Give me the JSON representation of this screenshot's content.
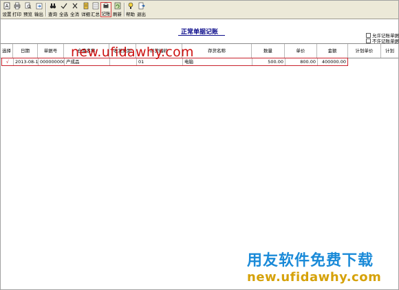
{
  "toolbar": {
    "buttons": [
      {
        "label": "设置",
        "icon": "settings-icon"
      },
      {
        "label": "打印",
        "icon": "printer-icon"
      },
      {
        "label": "预览",
        "icon": "preview-icon"
      },
      {
        "label": "输出",
        "icon": "export-icon"
      },
      {
        "label": "查询",
        "icon": "binoculars-icon"
      },
      {
        "label": "全选",
        "icon": "select-all-icon"
      },
      {
        "label": "全消",
        "icon": "clear-all-icon"
      },
      {
        "label": "详细",
        "icon": "detail-icon"
      },
      {
        "label": "汇总",
        "icon": "summary-icon"
      },
      {
        "label": "记账",
        "icon": "post-icon"
      },
      {
        "label": "刷新",
        "icon": "refresh-icon"
      },
      {
        "label": "帮助",
        "icon": "help-icon"
      },
      {
        "label": "退出",
        "icon": "exit-icon"
      }
    ],
    "active_label": "记账"
  },
  "page": {
    "title": "正常单据记账"
  },
  "options": {
    "allow_label": "允许记账单据",
    "disallow_label": "不许记账单据"
  },
  "table": {
    "headers": [
      "选择",
      "日期",
      "单据号",
      "仓库名称",
      "收发类别",
      "存货编码",
      "存货名称",
      "数量",
      "单价",
      "金额",
      "计划单价",
      "计划"
    ],
    "rows": [
      {
        "select": "√",
        "date": "2013-08-14",
        "doc_no": "0000000001",
        "warehouse": "产成品",
        "category": "",
        "item_code": "01",
        "item_name": "电脑",
        "qty": "500.00",
        "price": "800.00",
        "amount": "400000.00"
      }
    ]
  },
  "watermarks": {
    "top": "new.ufidawhy.com",
    "cn": "用友软件免费下载",
    "bottom": "new.ufidawhy.com"
  },
  "colors": {
    "title": "#0a0a8a",
    "selection_border": "#c8202a",
    "watermark_red": "#cc1111",
    "watermark_blue": "#1a8ad8",
    "watermark_gold": "#d6a20a"
  }
}
